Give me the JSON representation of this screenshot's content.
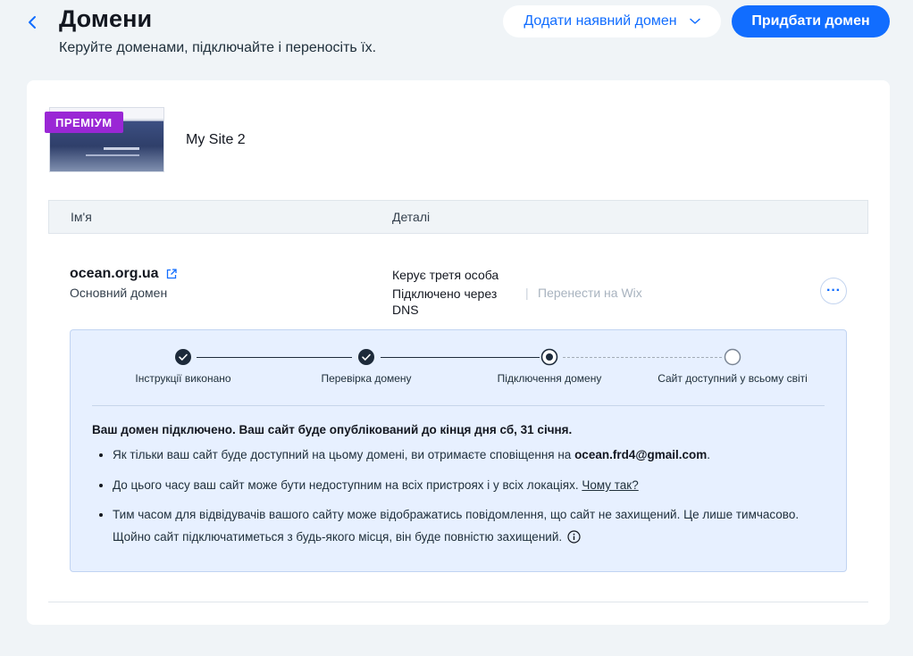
{
  "header": {
    "title": "Домени",
    "subtitle": "Керуйте доменами, підключайте і переносіть їх.",
    "add_existing_label": "Додати наявний домен",
    "buy_label": "Придбати домен"
  },
  "site": {
    "badge": "ПРЕМІУМ",
    "name": "My Site 2"
  },
  "table": {
    "col_name": "Ім'я",
    "col_details": "Деталі"
  },
  "domain": {
    "name": "ocean.org.ua",
    "type": "Основний домен",
    "managed_by": "Керує третя особа",
    "connected_via": "Підключено через DNS",
    "transfer_label": "Перенести на Wix",
    "more_label": "···"
  },
  "progress": {
    "steps": [
      {
        "label": "Інструкції виконано",
        "state": "done"
      },
      {
        "label": "Перевірка домену",
        "state": "done"
      },
      {
        "label": "Підключення домену",
        "state": "current"
      },
      {
        "label": "Сайт доступний у всьому світі",
        "state": "pending"
      }
    ],
    "heading": "Ваш домен підключено. Ваш сайт буде опублікований до кінця дня сб, 31 січня.",
    "bullet1_text": "Як тільки ваш сайт буде доступний на цьому домені, ви отримаєте сповіщення на ",
    "bullet1_email": "ocean.frd4@gmail.com",
    "bullet1_end": ".",
    "bullet2_text": "До цього часу ваш сайт може бути недоступним на всіх пристроях і у всіх локаціях. ",
    "bullet2_link": "Чому так?",
    "bullet3_text": "Тим часом для відвідувачів вашого сайту може відображатись повідомлення, що сайт не захищений. Це лише тимчасово. Щойно сайт підключатиметься з будь-якого місця, він буде повністю захищений."
  },
  "colors": {
    "accent": "#116dff",
    "premium": "#9a27d5",
    "panel_bg": "#e7f0ff"
  }
}
